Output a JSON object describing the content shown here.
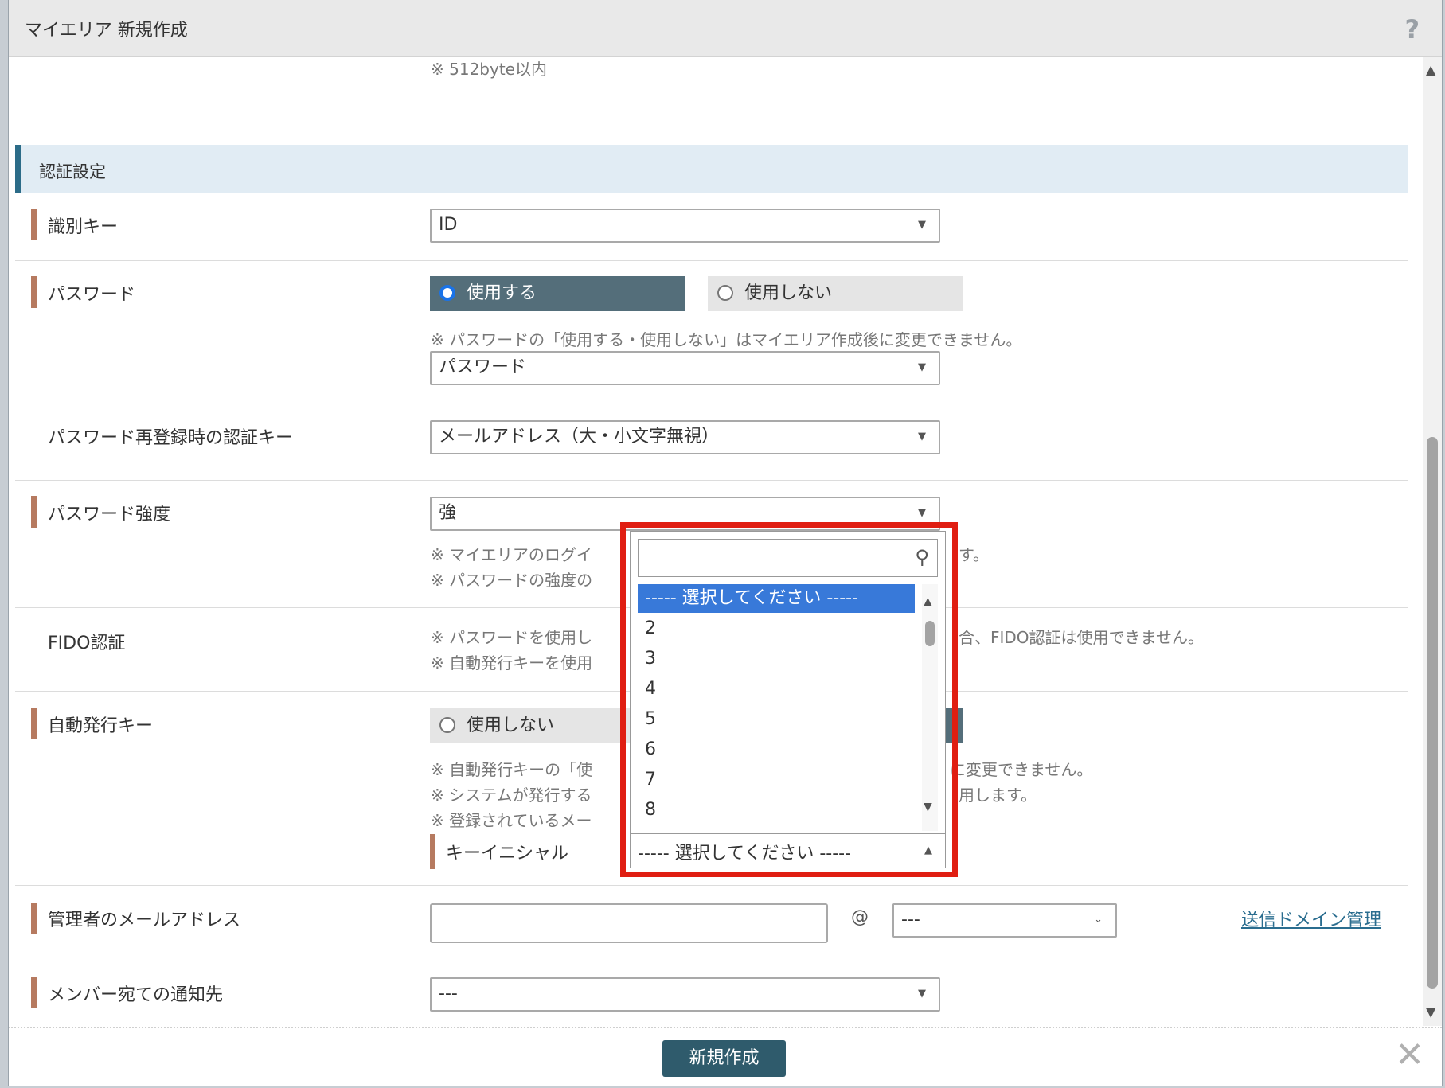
{
  "dialog": {
    "title": "マイエリア 新規作成",
    "help_icon": "?"
  },
  "notes": {
    "byte_limit": "※ 512byte以内",
    "password_change": "※ パスワードの「使用する・使用しない」はマイエリア作成後に変更できません。",
    "login_note_a": "※ マイエリアのログイ",
    "login_note_b": "す。",
    "strength_note": "※ パスワードの強度の",
    "fido_note1_a": "※ パスワードを使用し",
    "fido_note1_b": "合、FIDO認証は使用できません。",
    "fido_note2": "※ 自動発行キーを使用",
    "auto_note1_a": "※ 自動発行キーの「使",
    "auto_note1_b": "に変更できません。",
    "auto_note2_a": "※ システムが発行する",
    "auto_note2_b": "用します。",
    "auto_note3": "※ 登録されているメー"
  },
  "section": {
    "title": "認証設定"
  },
  "fields": {
    "identifier_key": {
      "label": "識別キー",
      "value": "ID"
    },
    "password": {
      "label": "パスワード",
      "radio_use": "使用する",
      "radio_not_use": "使用しない",
      "select_value": "パスワード"
    },
    "reregister_key": {
      "label": "パスワード再登録時の認証キー",
      "value": "メールアドレス（大・小文字無視）"
    },
    "password_strength": {
      "label": "パスワード強度",
      "value": "強"
    },
    "fido": {
      "label": "FIDO認証"
    },
    "auto_key": {
      "label": "自動発行キー",
      "radio_not_use": "使用しない"
    },
    "key_initial": {
      "label": "キーイニシャル",
      "value": "----- 選択してください -----"
    },
    "admin_email": {
      "label": "管理者のメールアドレス",
      "at": "@",
      "domain_value": "---",
      "domain_link": "送信ドメイン管理"
    },
    "member_notice": {
      "label": "メンバー宛ての通知先",
      "value": "---"
    }
  },
  "dropdown": {
    "search_placeholder": "",
    "options": [
      "----- 選択してください -----",
      "2",
      "3",
      "4",
      "5",
      "6",
      "7",
      "8"
    ],
    "selected_index": 0
  },
  "footer": {
    "create_button": "新規作成",
    "close_icon": "✕"
  },
  "colors": {
    "accent_section": "#2c6c88",
    "required_bar": "#b67a60",
    "radio_on_bg": "#546e7a",
    "highlight_frame": "#e01e12",
    "selected_option": "#3879d9",
    "primary_button": "#2f5b6c"
  }
}
